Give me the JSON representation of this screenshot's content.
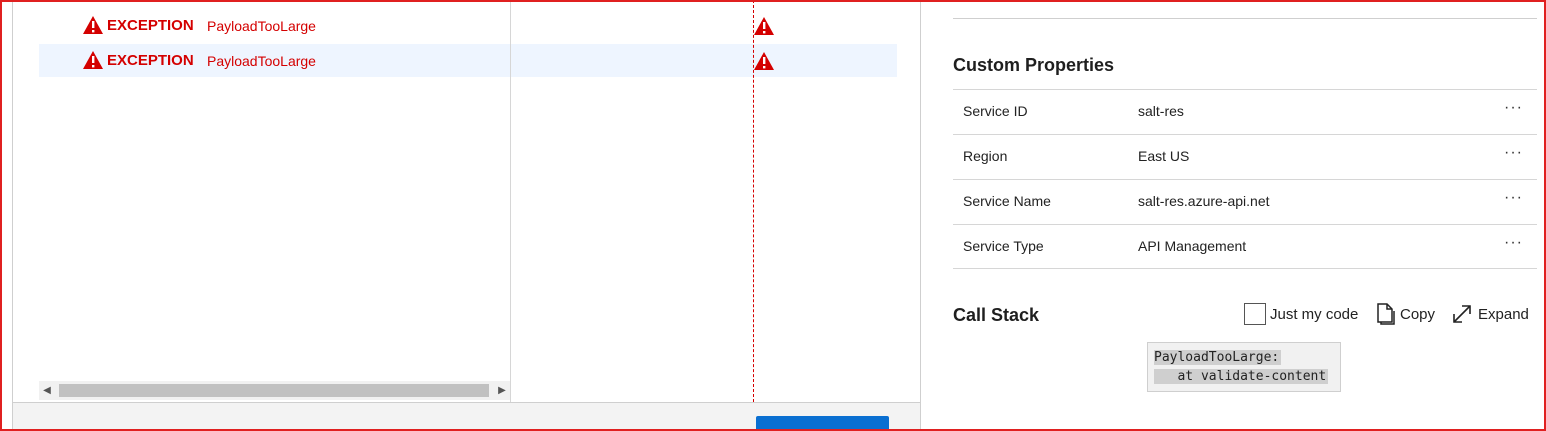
{
  "exceptions": [
    {
      "type": "EXCEPTION",
      "name": "PayloadTooLarge"
    },
    {
      "type": "EXCEPTION",
      "name": "PayloadTooLarge"
    }
  ],
  "custom_properties": {
    "title": "Custom Properties",
    "rows": [
      {
        "key": "Service ID",
        "value": "salt-res",
        "more": "···"
      },
      {
        "key": "Region",
        "value": "East US",
        "more": "···"
      },
      {
        "key": "Service Name",
        "value": "salt-res.azure-api.net",
        "more": "···"
      },
      {
        "key": "Service Type",
        "value": "API Management",
        "more": "···"
      }
    ]
  },
  "call_stack": {
    "title": "Call Stack",
    "just_my_code_label": "Just my code",
    "copy_label": "Copy",
    "expand_label": "Expand",
    "code_lines": [
      "PayloadTooLarge:",
      "   at validate-content"
    ]
  },
  "colors": {
    "error": "#d40000",
    "selected_row": "#eef5ff",
    "button": "#0a6fd1"
  }
}
